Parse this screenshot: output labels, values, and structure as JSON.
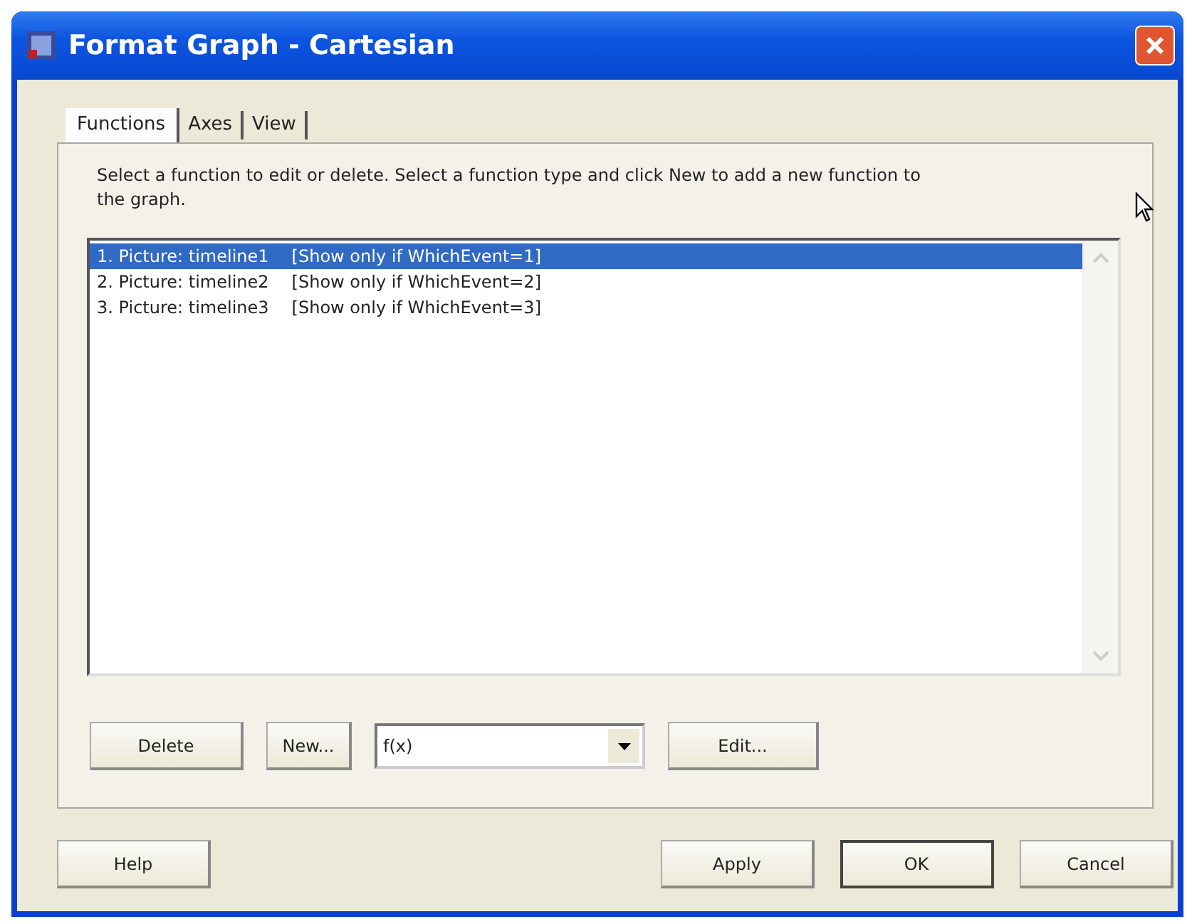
{
  "window": {
    "title": "Format Graph - Cartesian"
  },
  "tabs": [
    {
      "label": "Functions",
      "selected": true
    },
    {
      "label": "Axes",
      "selected": false
    },
    {
      "label": "View",
      "selected": false
    }
  ],
  "instructions": "Select a function to edit or delete.  Select a function type and click New to add a new function to the graph.",
  "functions": [
    {
      "name": "1. Picture: timeline1",
      "condition": "[Show only if WhichEvent=1]",
      "selected": true
    },
    {
      "name": "2. Picture: timeline2",
      "condition": "[Show only if WhichEvent=2]",
      "selected": false
    },
    {
      "name": "3. Picture: timeline3",
      "condition": "[Show only if WhichEvent=3]",
      "selected": false
    }
  ],
  "panel_buttons": [
    {
      "kind": "button",
      "label": "Delete"
    },
    {
      "kind": "button",
      "label": "New..."
    },
    {
      "kind": "dropdown",
      "value": "f(x)"
    },
    {
      "kind": "button",
      "label": "Edit..."
    }
  ],
  "dialog_buttons": [
    {
      "label": "Help",
      "default": false
    },
    {
      "label": "Apply",
      "default": false
    },
    {
      "label": "OK",
      "default": true
    },
    {
      "label": "Cancel",
      "default": false
    }
  ]
}
